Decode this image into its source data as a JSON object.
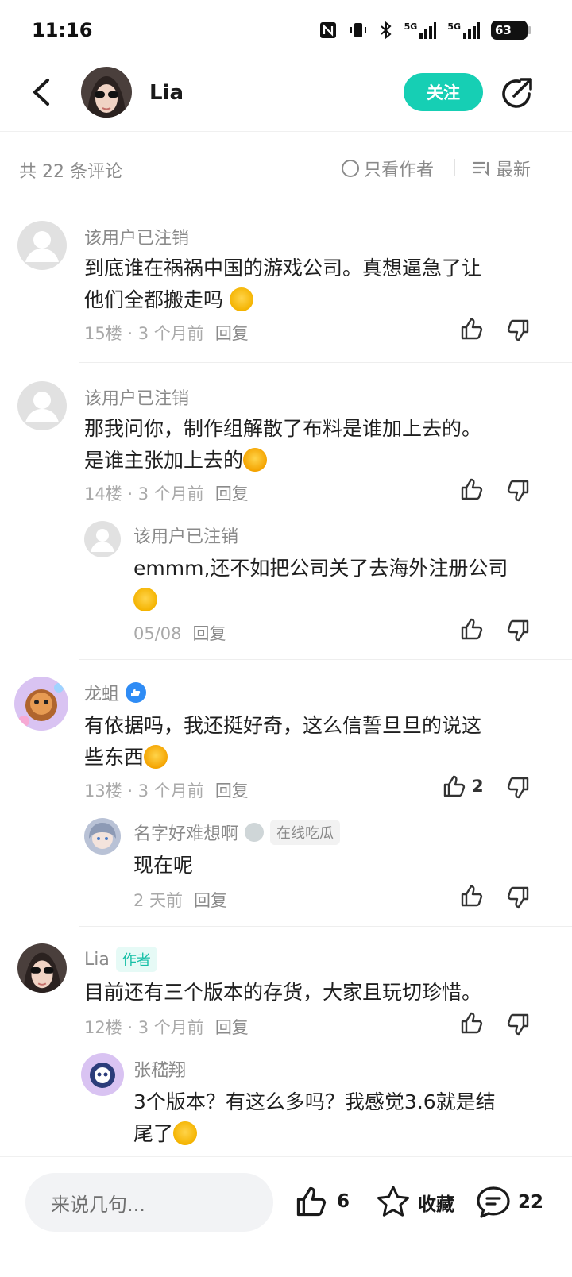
{
  "status_bar": {
    "time": "11:16",
    "battery": "63",
    "network_1": "5G",
    "network_2": "5G"
  },
  "header": {
    "username": "Lia",
    "follow_label": "关注"
  },
  "comments_bar": {
    "count_label": "共 22 条评论",
    "author_only_label": "只看作者",
    "sort_label": "最新"
  },
  "comments": [
    {
      "username": "该用户已注销",
      "text_line1": "到底谁在祸祸中国的游戏公司。真想逼急了让",
      "text_line2": "他们全都搬走吗",
      "floor": "15楼",
      "time": "3 个月前",
      "reply_label": "回复"
    },
    {
      "username": "该用户已注销",
      "text_line1": "那我问你，制作组解散了布料是谁加上去的。",
      "text_line2": "是谁主张加上去的",
      "floor": "14楼",
      "time": "3 个月前",
      "reply_label": "回复",
      "reply": {
        "username": "该用户已注销",
        "text": "emmm,还不如把公司关了去海外注册公司",
        "time": "05/08",
        "reply_label": "回复"
      }
    },
    {
      "username": "龙蛆",
      "text_line1": "有依据吗，我还挺好奇，这么信誓旦旦的说这",
      "text_line2": "些东西",
      "floor": "13楼",
      "time": "3 个月前",
      "reply_label": "回复",
      "likes": "2",
      "reply": {
        "username": "名字好难想啊",
        "badge": "在线吃瓜",
        "text": "现在呢",
        "time": "2 天前",
        "reply_label": "回复"
      }
    },
    {
      "username": "Lia",
      "author_tag": "作者",
      "text_line1": "目前还有三个版本的存货，大家且玩切珍惜。",
      "floor": "12楼",
      "time": "3 个月前",
      "reply_label": "回复",
      "reply": {
        "username": "张嵇翔",
        "text_line1": "3个版本？有这么多吗？我感觉3.6就是结",
        "text_line2": "尾了"
      }
    }
  ],
  "bottom_bar": {
    "input_placeholder": "来说几句...",
    "likes": "6",
    "favorite_label": "收藏",
    "comments": "22"
  },
  "colors": {
    "accent": "#16cfb4",
    "verified": "#2f8cf5",
    "muted": "#8a8a8a"
  },
  "icons": [
    "back-arrow-icon",
    "share-icon",
    "thumbs-up-icon",
    "thumbs-down-icon",
    "star-icon",
    "comment-icon",
    "sort-icon",
    "radio-icon",
    "verified-icon"
  ]
}
